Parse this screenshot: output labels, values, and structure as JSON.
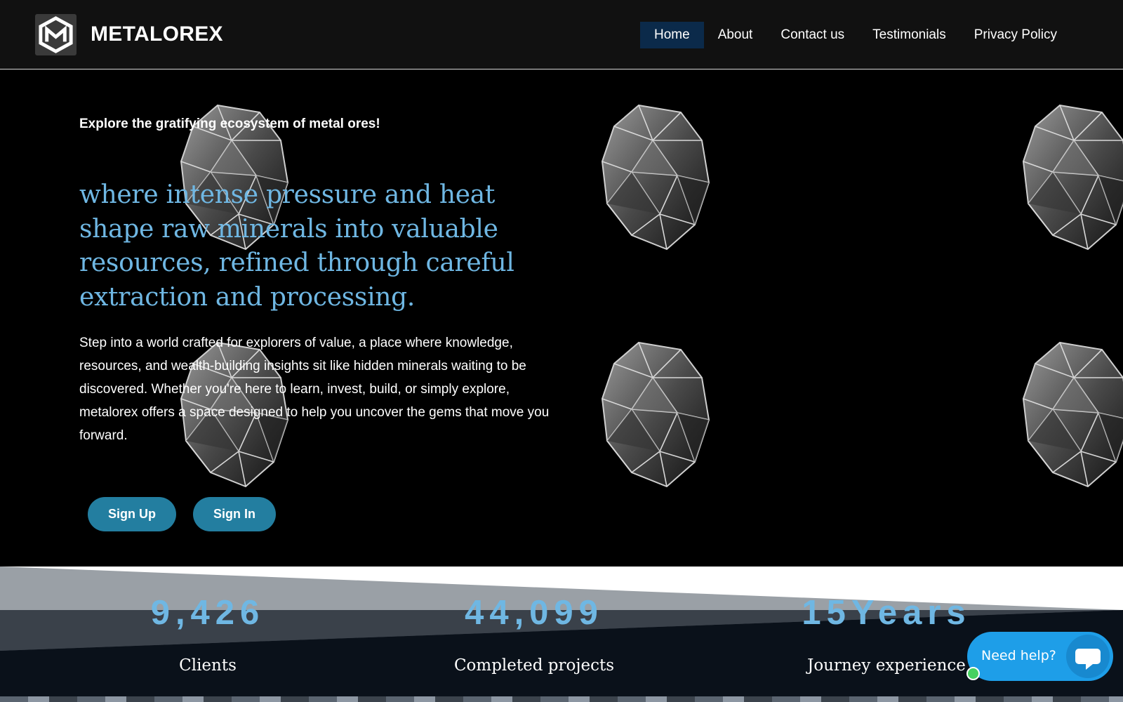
{
  "header": {
    "brand": "METALOREX",
    "logo_icon": "metalorex-hexagon-logo",
    "nav": [
      {
        "label": "Home",
        "active": true
      },
      {
        "label": "About",
        "active": false
      },
      {
        "label": "Contact us",
        "active": false
      },
      {
        "label": "Testimonials",
        "active": false
      },
      {
        "label": "Privacy Policy",
        "active": false
      }
    ]
  },
  "hero": {
    "kicker": "Explore the gratifying ecosystem of metal ores!",
    "headline": "where intense pressure and heat shape raw minerals into valuable resources, refined through careful extraction and processing.",
    "body": "Step into a world crafted for explorers of value,  a place where knowledge, resources, and wealth-building insights sit like hidden minerals waiting to be discovered. Whether you're here to learn, invest, build, or simply explore, metalorex offers a space designed to help you uncover the gems that move you forward.",
    "buttons": {
      "signup": "Sign Up",
      "signin": "Sign In"
    },
    "background_icon": "polyhedron-gem-icon"
  },
  "stats": [
    {
      "value": "9,426",
      "label": "Clients"
    },
    {
      "value": "44,099",
      "label": "Completed projects"
    },
    {
      "value": "15Years",
      "label": "Journey experience"
    }
  ],
  "help_widget": {
    "label": "Need help?",
    "icon": "chat-bubble-icon",
    "status": "online"
  },
  "colors": {
    "accent": "#6fb7e3",
    "button": "#237ea0",
    "nav_active": "#0b2a4a",
    "help": "#1e9ee8",
    "online": "#46d160"
  }
}
